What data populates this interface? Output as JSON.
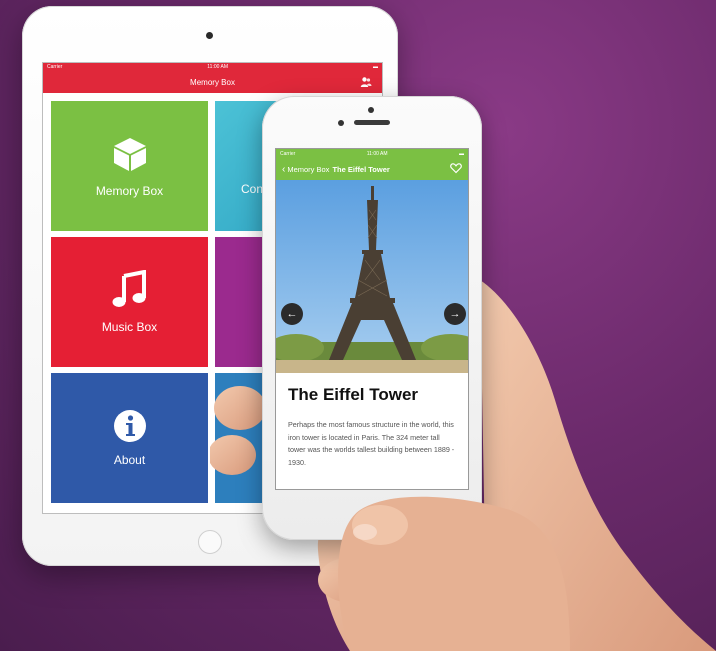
{
  "ipad": {
    "status": {
      "carrier": "Carrier",
      "time": "11:00 AM"
    },
    "nav_title": "Memory Box",
    "nav_icon": "people-icon",
    "tiles": [
      {
        "label": "Memory Box",
        "icon": "box-icon",
        "color": "#7bc043"
      },
      {
        "label": "Con",
        "icon": "",
        "color": "#3fb6d0"
      },
      {
        "label": "Music Box",
        "icon": "music-note-icon",
        "color": "#e51f34"
      },
      {
        "label": "",
        "icon": "",
        "color": "#9b2a8e"
      },
      {
        "label": "About",
        "icon": "info-icon",
        "color": "#2f59a8"
      },
      {
        "label": "",
        "icon": "",
        "color": "#2d7fbd"
      }
    ]
  },
  "iphone": {
    "status": {
      "carrier": "Carrier",
      "time": "11:00 AM"
    },
    "nav": {
      "back_label": "Memory Box",
      "title": "The Eiffel Tower",
      "right_icon": "heart-icon"
    },
    "gallery": {
      "prev_icon": "arrow-left-icon",
      "next_icon": "arrow-right-icon"
    },
    "article": {
      "title": "The Eiffel Tower",
      "body": "Perhaps the most famous structure in the world, this iron tower is located in Paris. The 324 meter tall tower was the worlds tallest building between 1889 - 1930."
    }
  },
  "colors": {
    "background": "#6b2a6b",
    "ipad_accent": "#e0283a",
    "iphone_accent": "#7bc043"
  }
}
